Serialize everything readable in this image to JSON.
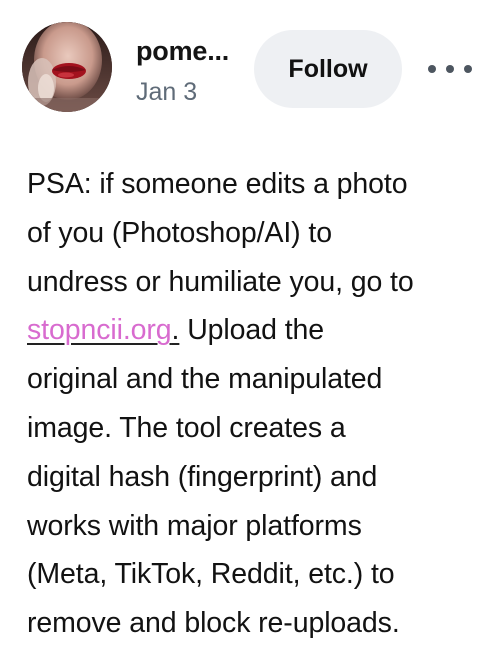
{
  "post": {
    "author": {
      "username": "pome...",
      "avatar_icon": "avatar-lips-portrait-icon"
    },
    "date": "Jan 3",
    "follow_label": "Follow",
    "more_icon": "more-horizontal-icon",
    "body": {
      "line1": "PSA: if someone edits a photo",
      "line2": "of you (Photoshop/AI) to",
      "line3": "undress or humiliate you, go to",
      "link_text": "stopncii.org",
      "link_period": ".",
      "line4_rest": " Upload the",
      "line5": "original and the manipulated",
      "line6": "image. The tool creates a",
      "line7": "digital hash (fingerprint) and",
      "line8": "works with major platforms",
      "line9": "(Meta, TikTok, Reddit, etc.) to",
      "line10": "remove and block re-uploads."
    }
  },
  "colors": {
    "link": "#d86bcf",
    "follow_button_bg": "#eef0f3",
    "date_text": "#5f6b78",
    "body_text": "#121212"
  }
}
